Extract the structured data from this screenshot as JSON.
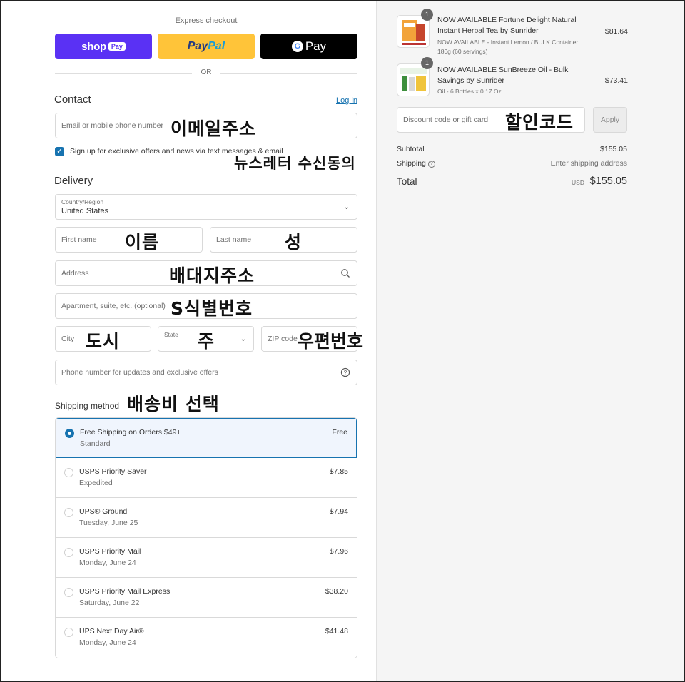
{
  "express": {
    "title": "Express checkout",
    "shop_word": "shop",
    "shop_pay": "Pay",
    "paypal_a": "Pay",
    "paypal_b": "Pal",
    "gpay_g": "G",
    "gpay_word": "Pay",
    "or": "OR"
  },
  "contact": {
    "title": "Contact",
    "login": "Log in",
    "email_placeholder": "Email or mobile phone number",
    "email_note": "이메일주소",
    "signup_label": "Sign up for exclusive offers and news via text messages & email",
    "signup_note": "뉴스레터 수신동의"
  },
  "delivery": {
    "title": "Delivery",
    "country_label": "Country/Region",
    "country_value": "United States",
    "first_name": "First name",
    "first_note": "이름",
    "last_name": "Last name",
    "last_note": "성",
    "address": "Address",
    "address_note": "배대지주소",
    "apartment": "Apartment, suite, etc. (optional)",
    "apartment_note": "S식별번호",
    "city": "City",
    "city_note": "도시",
    "state": "State",
    "state_note": "주",
    "zip": "ZIP code",
    "zip_note": "우편번호",
    "phone": "Phone number for updates and exclusive offers"
  },
  "shipping": {
    "title": "Shipping method",
    "title_note": "배송비 선택",
    "options": [
      {
        "name": "Free Shipping on Orders $49+",
        "sub": "Standard",
        "price": "Free"
      },
      {
        "name": "USPS Priority Saver",
        "sub": "Expedited",
        "price": "$7.85"
      },
      {
        "name": "UPS® Ground",
        "sub": "Tuesday, June 25",
        "price": "$7.94"
      },
      {
        "name": "USPS Priority Mail",
        "sub": "Monday, June 24",
        "price": "$7.96"
      },
      {
        "name": "USPS Priority Mail Express",
        "sub": "Saturday, June 22",
        "price": "$38.20"
      },
      {
        "name": "UPS Next Day Air®",
        "sub": "Monday, June 24",
        "price": "$41.48"
      }
    ],
    "selected_index": 0
  },
  "cart": {
    "items": [
      {
        "qty": "1",
        "name": "NOW AVAILABLE Fortune Delight Natural Instant Herbal Tea by Sunrider",
        "meta1": "NOW AVAILABLE - Instant Lemon / BULK Container",
        "meta2": "180g (60 servings)",
        "price": "$81.64"
      },
      {
        "qty": "1",
        "name": "NOW AVAILABLE SunBreeze Oil - Bulk Savings by Sunrider",
        "meta1": "Oil - 6 Bottles x 0.17 Oz",
        "price": "$73.41"
      }
    ],
    "discount_placeholder": "Discount code or gift card",
    "discount_note": "할인코드",
    "apply": "Apply",
    "subtotal_label": "Subtotal",
    "subtotal_value": "$155.05",
    "shipping_label": "Shipping",
    "shipping_value": "Enter shipping address",
    "total_label": "Total",
    "currency": "USD",
    "total_value": "$155.05"
  },
  "colors": {
    "accent": "#1773b0",
    "shop_pay": "#5a31f4",
    "paypal": "#ffc439",
    "gpay": "#000000",
    "sidebar_bg": "#f5f5f5"
  }
}
